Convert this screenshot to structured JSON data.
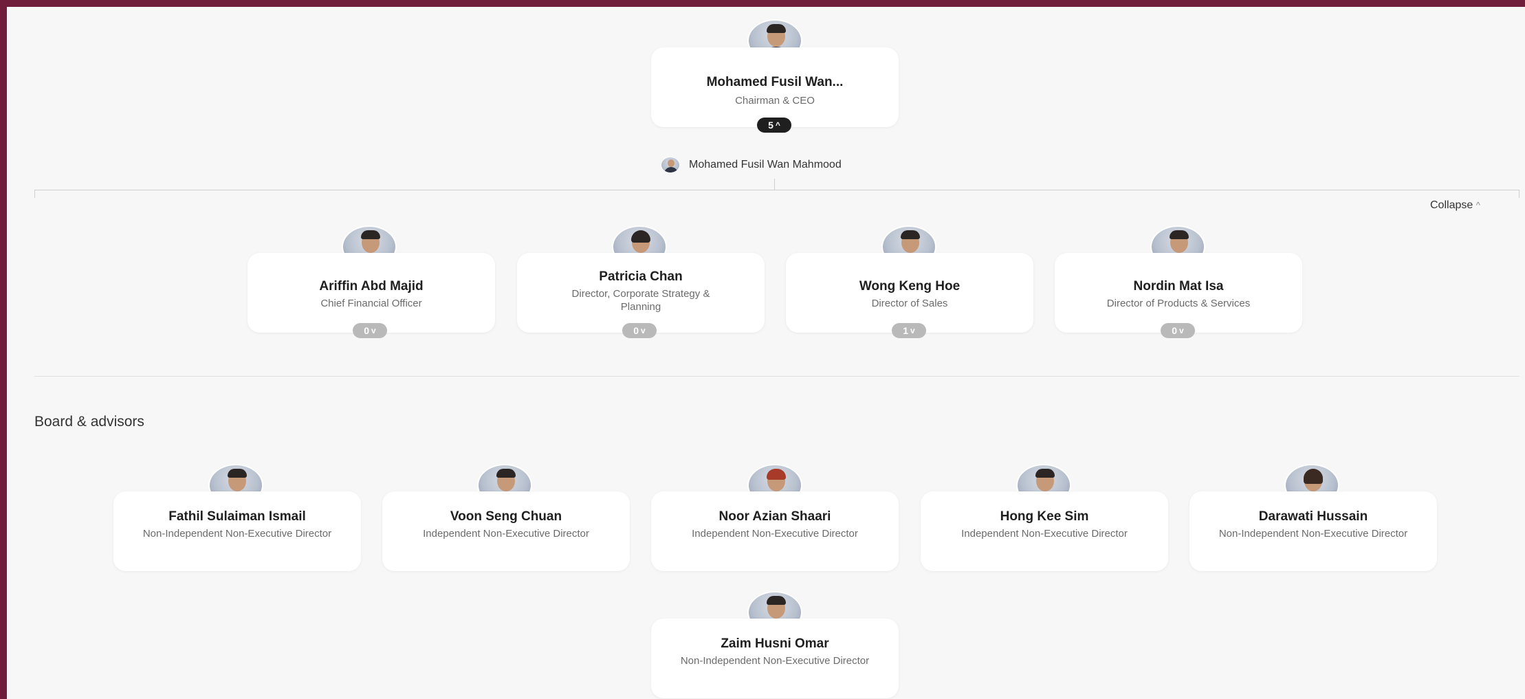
{
  "ceo": {
    "name": "Mohamed Fusil Wan...",
    "role": "Chairman & CEO",
    "reports_count": "5",
    "full_name": "Mohamed Fusil Wan Mahmood"
  },
  "collapse_label": "Collapse",
  "direct_reports": [
    {
      "name": "Ariffin Abd Majid",
      "role": "Chief Financial Officer",
      "count": "0"
    },
    {
      "name": "Patricia Chan",
      "role": "Director, Corporate Strategy & Planning",
      "count": "0"
    },
    {
      "name": "Wong Keng Hoe",
      "role": "Director of Sales",
      "count": "1"
    },
    {
      "name": "Nordin Mat Isa",
      "role": "Director of Products & Services",
      "count": "0"
    }
  ],
  "board": {
    "title": "Board & advisors",
    "members": [
      {
        "name": "Fathil Sulaiman Ismail",
        "role": "Non-Independent Non-Executive Director"
      },
      {
        "name": "Voon Seng Chuan",
        "role": "Independent Non-Executive Director"
      },
      {
        "name": "Noor Azian Shaari",
        "role": "Independent Non-Executive Director"
      },
      {
        "name": "Hong Kee Sim",
        "role": "Independent Non-Executive Director"
      },
      {
        "name": "Darawati Hussain",
        "role": "Non-Independent Non-Executive Director"
      },
      {
        "name": "Zaim Husni Omar",
        "role": "Non-Independent Non-Executive Director"
      }
    ]
  },
  "colors": {
    "frame": "#6f1d3a",
    "badge_dark": "#1f1f1f",
    "badge_light": "#b9b9b9"
  }
}
